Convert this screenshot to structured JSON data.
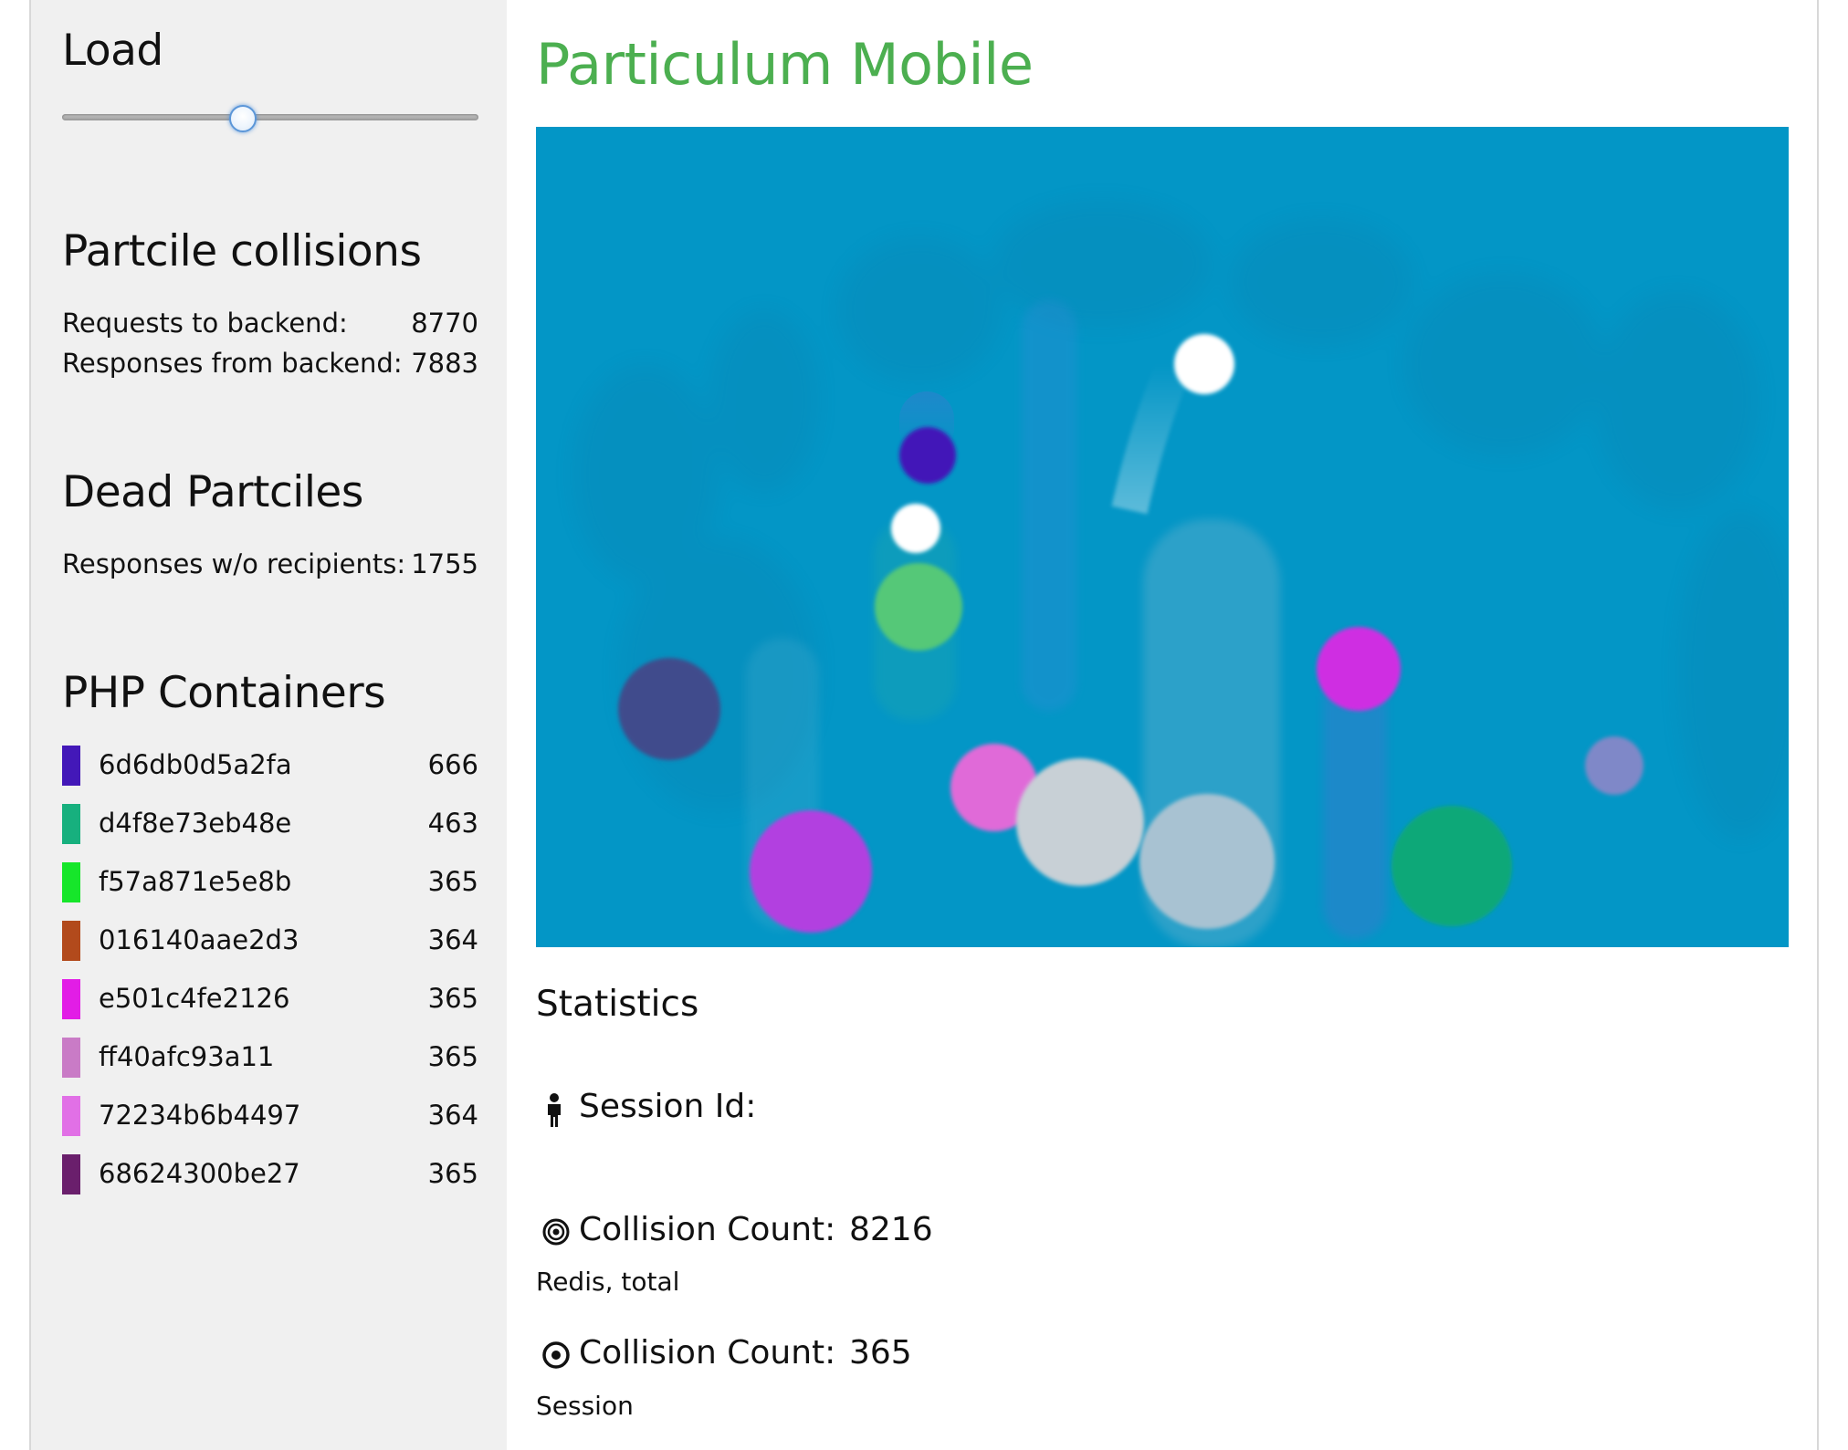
{
  "app": {
    "title": "Particulum Mobile"
  },
  "sidebar": {
    "load": {
      "label": "Load",
      "value_fraction": 0.43
    },
    "collisions": {
      "title": "Partcile collisions",
      "rows": [
        {
          "label": "Requests to backend:",
          "value": "8770"
        },
        {
          "label": "Responses from backend:",
          "value": "7883"
        }
      ]
    },
    "dead": {
      "title": "Dead Partciles",
      "rows": [
        {
          "label": "Responses w/o recipients:",
          "value": "1755"
        }
      ]
    },
    "containers": {
      "title": "PHP Containers",
      "items": [
        {
          "id": "6d6db0d5a2fa",
          "count": "666",
          "color": "#4318b8"
        },
        {
          "id": "d4f8e73eb48e",
          "count": "463",
          "color": "#17b07e"
        },
        {
          "id": "f57a871e5e8b",
          "count": "365",
          "color": "#16e62a"
        },
        {
          "id": "016140aae2d3",
          "count": "364",
          "color": "#b24a1c"
        },
        {
          "id": "e501c4fe2126",
          "count": "365",
          "color": "#e21de6"
        },
        {
          "id": "ff40afc93a11",
          "count": "365",
          "color": "#c97bc6"
        },
        {
          "id": "72234b6b4497",
          "count": "364",
          "color": "#e170e6"
        },
        {
          "id": "68624300be27",
          "count": "365",
          "color": "#6a1f6c"
        }
      ]
    }
  },
  "canvas": {
    "background": "#0396c6",
    "particle_colors": [
      "#ffffff",
      "#4318b8",
      "#55c878",
      "#414c8c",
      "#b23fe0",
      "#e06ad8",
      "#c8d0d6",
      "#a8c2d2",
      "#cf2fe2",
      "#10a878",
      "#7f88c8"
    ]
  },
  "statistics": {
    "title": "Statistics",
    "session": {
      "icon": "person-icon",
      "label": "Session Id:",
      "value": ""
    },
    "collision_total": {
      "icon": "target-icon",
      "label": "Collision Count:",
      "value": "8216",
      "sub": "Redis, total"
    },
    "collision_session": {
      "icon": "bullseye-icon",
      "label": "Collision Count:",
      "value": "365",
      "sub": "Session"
    }
  }
}
